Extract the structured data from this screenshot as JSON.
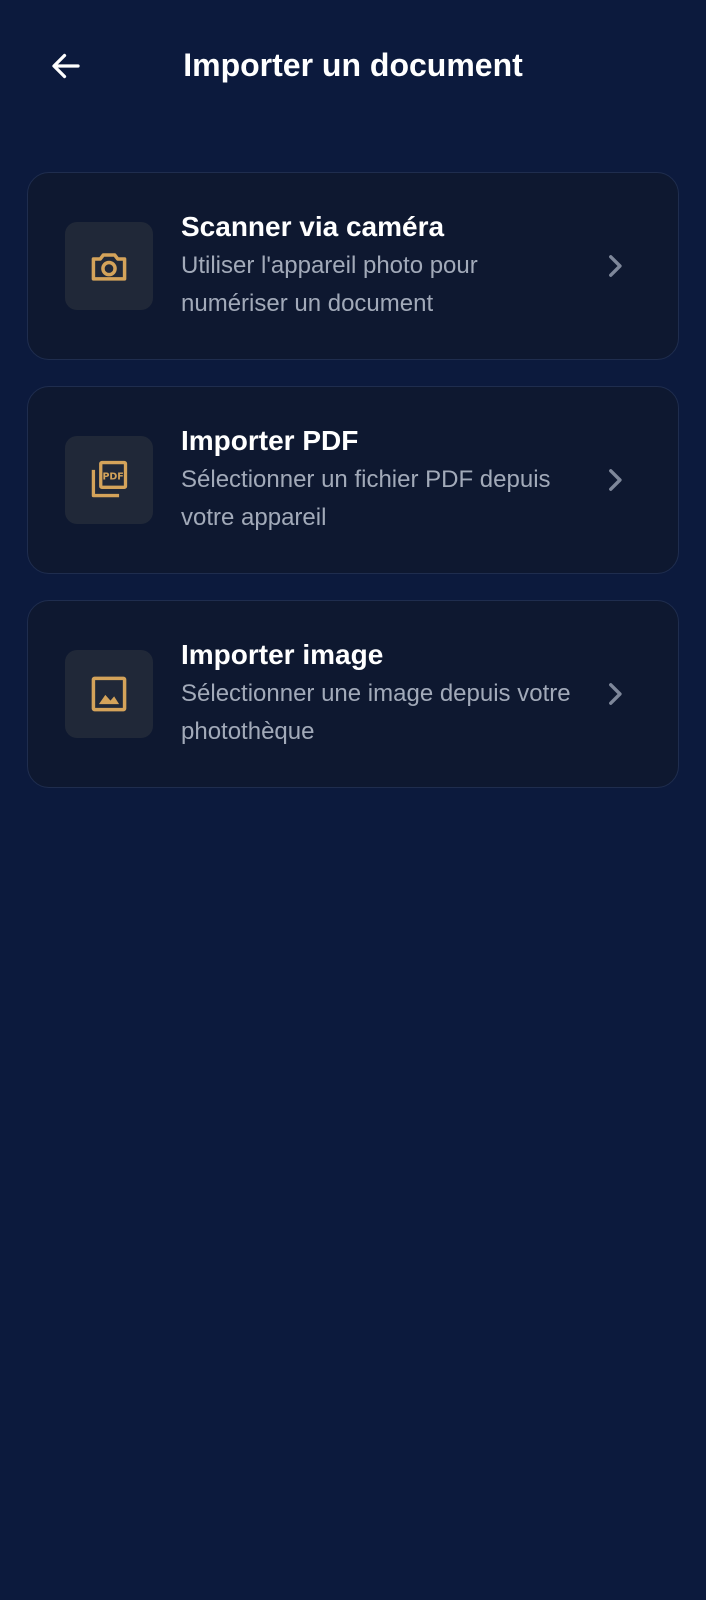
{
  "header": {
    "title": "Importer un document",
    "back_icon": "arrow-left-icon"
  },
  "options": [
    {
      "icon": "camera-icon",
      "title": "Scanner via caméra",
      "description": "Utiliser l'appareil photo pour numériser un document"
    },
    {
      "icon": "pdf-file-icon",
      "title": "Importer PDF",
      "description": "Sélectionner un fichier PDF depuis votre appareil"
    },
    {
      "icon": "image-icon",
      "title": "Importer image",
      "description": "Sélectionner une image depuis votre photothèque"
    }
  ],
  "colors": {
    "background": "#0c1a3d",
    "card": "#0e1830",
    "card_border": "#1f2d4e",
    "icon_box": "#202838",
    "accent": "#d4a35a",
    "text_secondary": "#a2aab9",
    "chevron": "#7e879a"
  }
}
